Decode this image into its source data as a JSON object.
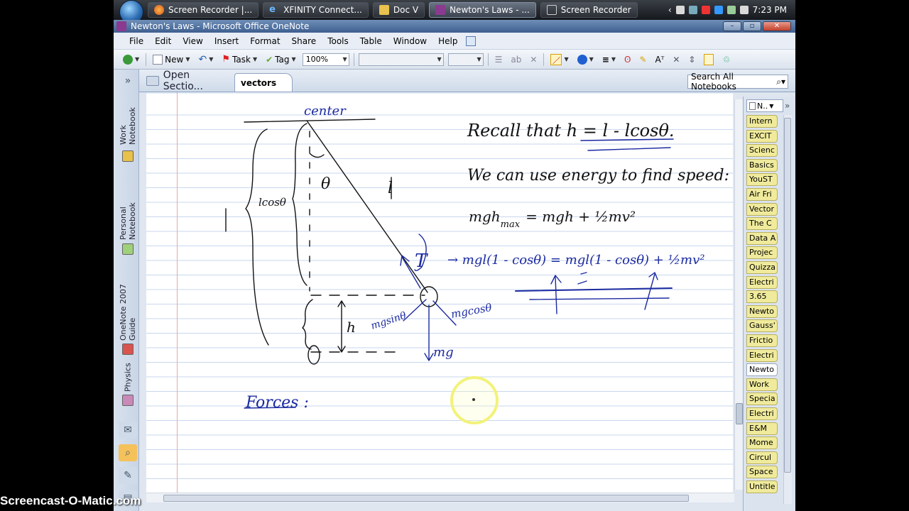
{
  "taskbar": {
    "tasks": [
      {
        "label": "Screen Recorder |...",
        "active": false
      },
      {
        "label": "XFINITY Connect...",
        "active": false
      },
      {
        "label": "Doc V",
        "active": false
      },
      {
        "label": "Newton's Laws - ...",
        "active": true
      },
      {
        "label": "Screen Recorder",
        "active": false
      }
    ],
    "clock": "7:23 PM"
  },
  "window": {
    "title": "Newton's Laws - Microsoft Office OneNote",
    "buttons": [
      "–",
      "▫",
      "✕"
    ]
  },
  "menu": [
    "File",
    "Edit",
    "View",
    "Insert",
    "Format",
    "Share",
    "Tools",
    "Table",
    "Window",
    "Help"
  ],
  "toolbar": {
    "new_label": "New",
    "task_label": "Task",
    "tag_label": "Tag",
    "zoom": "100%"
  },
  "left_notebooks": [
    {
      "label": "Work Notebook",
      "color": "#e8c14a"
    },
    {
      "label": "Personal Notebook",
      "color": "#9fd07a"
    },
    {
      "label": "OneNote 2007 Guide",
      "color": "#d9534f"
    },
    {
      "label": "Physics",
      "color": "#c98ab9"
    }
  ],
  "sections": {
    "open_sections": "Open Sectio...",
    "active_tab": "vectors",
    "search_placeholder": "Search All Notebooks"
  },
  "page_tabs": {
    "header": "N..",
    "items": [
      "Intern",
      "EXCIT",
      "Scienc",
      "Basics",
      "YouST",
      "Air Fri",
      "Vector",
      "The C",
      "Data A",
      "Projec",
      "Quizza",
      "Electri",
      "3.65",
      "Newto",
      "Gauss'",
      "Frictio",
      "Electri",
      "Newto",
      "Work",
      "Specia",
      "Electri",
      "E&M",
      "Mome",
      "Circul",
      "Space",
      "Untitle"
    ],
    "selected_index": 17
  },
  "ink": {
    "center": "center",
    "recall": "Recall that h = l - lcosθ.",
    "energy": "We can use energy to find speed:",
    "eq1": "mgh",
    "eq1_sub": "max",
    "eq1_rest": "= mgh + ½mv²",
    "eq2": "→ mgl(1 - cosθ",
    "eq2_rest": ") = mgl(1 - cosθ) + ½mv²",
    "l_label": "l",
    "lcos_label": "lcosθ",
    "theta": "θ",
    "T": "T",
    "h": "h",
    "mgsin": "mgsinθ",
    "mgcos": "mgcosθ",
    "mg": "mg",
    "forces": "Forces :"
  },
  "watermark": "Screencast-O-Matic.com"
}
